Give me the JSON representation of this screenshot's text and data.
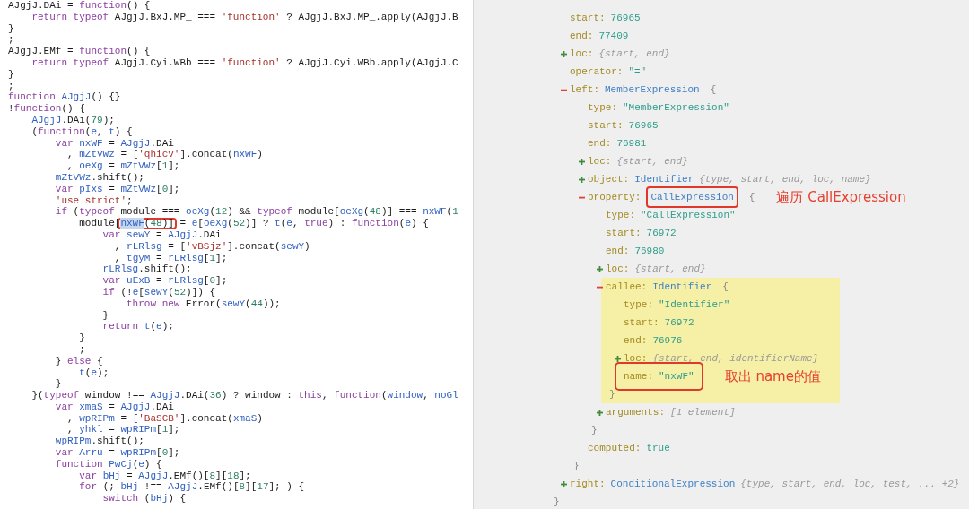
{
  "code": {
    "lines": [
      [
        {
          "kind": "plain",
          "text": "AJgjJ.DAi = "
        },
        {
          "kind": "keyword",
          "text": "function"
        },
        {
          "kind": "plain",
          "text": "() {"
        }
      ],
      [
        {
          "kind": "keyword",
          "text": "    return typeof"
        },
        {
          "kind": "plain",
          "text": " AJgjJ.BxJ.MP_ === "
        },
        {
          "kind": "string",
          "text": "'function'"
        },
        {
          "kind": "plain",
          "text": " ? AJgjJ.BxJ.MP_.apply(AJgjJ.B"
        }
      ],
      [
        {
          "kind": "plain",
          "text": "}"
        }
      ],
      [
        {
          "kind": "plain",
          "text": ";"
        }
      ],
      [
        {
          "kind": "plain",
          "text": "AJgjJ.EMf = "
        },
        {
          "kind": "keyword",
          "text": "function"
        },
        {
          "kind": "plain",
          "text": "() {"
        }
      ],
      [
        {
          "kind": "keyword",
          "text": "    return typeof"
        },
        {
          "kind": "plain",
          "text": " AJgjJ.Cyi.WBb === "
        },
        {
          "kind": "string",
          "text": "'function'"
        },
        {
          "kind": "plain",
          "text": " ? AJgjJ.Cyi.WBb.apply(AJgjJ.C"
        }
      ],
      [
        {
          "kind": "plain",
          "text": "}"
        }
      ],
      [
        {
          "kind": "plain",
          "text": ";"
        }
      ],
      [
        {
          "kind": "keyword",
          "text": "function "
        },
        {
          "kind": "name",
          "text": "AJgjJ"
        },
        {
          "kind": "plain",
          "text": "() {}"
        }
      ],
      [
        {
          "kind": "plain",
          "text": "!"
        },
        {
          "kind": "keyword",
          "text": "function"
        },
        {
          "kind": "plain",
          "text": "() {"
        }
      ],
      [
        {
          "kind": "name",
          "text": "    AJgjJ"
        },
        {
          "kind": "plain",
          "text": ".DAi("
        },
        {
          "kind": "number",
          "text": "79"
        },
        {
          "kind": "plain",
          "text": ");"
        }
      ],
      [
        {
          "kind": "plain",
          "text": "    ("
        },
        {
          "kind": "keyword",
          "text": "function"
        },
        {
          "kind": "plain",
          "text": "("
        },
        {
          "kind": "name",
          "text": "e"
        },
        {
          "kind": "plain",
          "text": ", "
        },
        {
          "kind": "name",
          "text": "t"
        },
        {
          "kind": "plain",
          "text": ") {"
        }
      ],
      [
        {
          "kind": "keyword",
          "text": "        var "
        },
        {
          "kind": "name",
          "text": "nxWF"
        },
        {
          "kind": "plain",
          "text": " = "
        },
        {
          "kind": "name",
          "text": "AJgjJ"
        },
        {
          "kind": "plain",
          "text": ".DAi"
        }
      ],
      [
        {
          "kind": "plain",
          "text": "          , "
        },
        {
          "kind": "name",
          "text": "mZtVWz"
        },
        {
          "kind": "plain",
          "text": " = ["
        },
        {
          "kind": "string",
          "text": "'qhicV'"
        },
        {
          "kind": "plain",
          "text": "].concat("
        },
        {
          "kind": "name",
          "text": "nxWF"
        },
        {
          "kind": "plain",
          "text": ")"
        }
      ],
      [
        {
          "kind": "plain",
          "text": "          , "
        },
        {
          "kind": "name",
          "text": "oeXg"
        },
        {
          "kind": "plain",
          "text": " = "
        },
        {
          "kind": "name",
          "text": "mZtVWz"
        },
        {
          "kind": "plain",
          "text": "["
        },
        {
          "kind": "number",
          "text": "1"
        },
        {
          "kind": "plain",
          "text": "];"
        }
      ],
      [
        {
          "kind": "name",
          "text": "        mZtVWz"
        },
        {
          "kind": "plain",
          "text": ".shift();"
        }
      ],
      [
        {
          "kind": "keyword",
          "text": "        var "
        },
        {
          "kind": "name",
          "text": "pIxs"
        },
        {
          "kind": "plain",
          "text": " = "
        },
        {
          "kind": "name",
          "text": "mZtVWz"
        },
        {
          "kind": "plain",
          "text": "["
        },
        {
          "kind": "number",
          "text": "0"
        },
        {
          "kind": "plain",
          "text": "];"
        }
      ],
      [
        {
          "kind": "string",
          "text": "        'use strict'"
        },
        {
          "kind": "plain",
          "text": ";"
        }
      ],
      [
        {
          "kind": "keyword",
          "text": "        if"
        },
        {
          "kind": "plain",
          "text": " ("
        },
        {
          "kind": "keyword",
          "text": "typeof"
        },
        {
          "kind": "plain",
          "text": " module === "
        },
        {
          "kind": "name",
          "text": "oeXg"
        },
        {
          "kind": "plain",
          "text": "("
        },
        {
          "kind": "number",
          "text": "12"
        },
        {
          "kind": "plain",
          "text": ") && "
        },
        {
          "kind": "keyword",
          "text": "typeof"
        },
        {
          "kind": "plain",
          "text": " module["
        },
        {
          "kind": "name",
          "text": "oeXg"
        },
        {
          "kind": "plain",
          "text": "("
        },
        {
          "kind": "number",
          "text": "48"
        },
        {
          "kind": "plain",
          "text": ")] === "
        },
        {
          "kind": "name",
          "text": "nxWF"
        },
        {
          "kind": "plain",
          "text": "("
        },
        {
          "kind": "number",
          "text": "1"
        }
      ],
      [
        {
          "kind": "plain",
          "text": "            module["
        },
        {
          "kind": "outlined",
          "tokens": [
            {
              "kind": "match",
              "text": "nxWF"
            },
            {
              "kind": "plain",
              "text": "("
            },
            {
              "kind": "number",
              "text": "48"
            },
            {
              "kind": "plain",
              "text": ")]"
            }
          ]
        },
        {
          "kind": "plain",
          "text": " = "
        },
        {
          "kind": "name",
          "text": "e"
        },
        {
          "kind": "plain",
          "text": "["
        },
        {
          "kind": "name",
          "text": "oeXg"
        },
        {
          "kind": "plain",
          "text": "("
        },
        {
          "kind": "number",
          "text": "52"
        },
        {
          "kind": "plain",
          "text": ")] ? "
        },
        {
          "kind": "name",
          "text": "t"
        },
        {
          "kind": "plain",
          "text": "("
        },
        {
          "kind": "name",
          "text": "e"
        },
        {
          "kind": "plain",
          "text": ", "
        },
        {
          "kind": "keyword",
          "text": "true"
        },
        {
          "kind": "plain",
          "text": ") : "
        },
        {
          "kind": "keyword",
          "text": "function"
        },
        {
          "kind": "plain",
          "text": "("
        },
        {
          "kind": "name",
          "text": "e"
        },
        {
          "kind": "plain",
          "text": ") {"
        }
      ],
      [
        {
          "kind": "keyword",
          "text": "                var "
        },
        {
          "kind": "name",
          "text": "sewY"
        },
        {
          "kind": "plain",
          "text": " = "
        },
        {
          "kind": "name",
          "text": "AJgjJ"
        },
        {
          "kind": "plain",
          "text": ".DAi"
        }
      ],
      [
        {
          "kind": "plain",
          "text": "                  , "
        },
        {
          "kind": "name",
          "text": "rLRlsg"
        },
        {
          "kind": "plain",
          "text": " = ["
        },
        {
          "kind": "string",
          "text": "'vBSjz'"
        },
        {
          "kind": "plain",
          "text": "].concat("
        },
        {
          "kind": "name",
          "text": "sewY"
        },
        {
          "kind": "plain",
          "text": ")"
        }
      ],
      [
        {
          "kind": "plain",
          "text": "                  , "
        },
        {
          "kind": "name",
          "text": "tgyM"
        },
        {
          "kind": "plain",
          "text": " = "
        },
        {
          "kind": "name",
          "text": "rLRlsg"
        },
        {
          "kind": "plain",
          "text": "["
        },
        {
          "kind": "number",
          "text": "1"
        },
        {
          "kind": "plain",
          "text": "];"
        }
      ],
      [
        {
          "kind": "name",
          "text": "                rLRlsg"
        },
        {
          "kind": "plain",
          "text": ".shift();"
        }
      ],
      [
        {
          "kind": "keyword",
          "text": "                var "
        },
        {
          "kind": "name",
          "text": "uExB"
        },
        {
          "kind": "plain",
          "text": " = "
        },
        {
          "kind": "name",
          "text": "rLRlsg"
        },
        {
          "kind": "plain",
          "text": "["
        },
        {
          "kind": "number",
          "text": "0"
        },
        {
          "kind": "plain",
          "text": "];"
        }
      ],
      [
        {
          "kind": "keyword",
          "text": "                if"
        },
        {
          "kind": "plain",
          "text": " (!"
        },
        {
          "kind": "name",
          "text": "e"
        },
        {
          "kind": "plain",
          "text": "["
        },
        {
          "kind": "name",
          "text": "sewY"
        },
        {
          "kind": "plain",
          "text": "("
        },
        {
          "kind": "number",
          "text": "52"
        },
        {
          "kind": "plain",
          "text": ")]) {"
        }
      ],
      [
        {
          "kind": "keyword",
          "text": "                    throw new"
        },
        {
          "kind": "plain",
          "text": " Error("
        },
        {
          "kind": "name",
          "text": "sewY"
        },
        {
          "kind": "plain",
          "text": "("
        },
        {
          "kind": "number",
          "text": "44"
        },
        {
          "kind": "plain",
          "text": "));"
        }
      ],
      [
        {
          "kind": "plain",
          "text": "                }"
        }
      ],
      [
        {
          "kind": "keyword",
          "text": "                return "
        },
        {
          "kind": "name",
          "text": "t"
        },
        {
          "kind": "plain",
          "text": "("
        },
        {
          "kind": "name",
          "text": "e"
        },
        {
          "kind": "plain",
          "text": ");"
        }
      ],
      [
        {
          "kind": "plain",
          "text": "            }"
        }
      ],
      [
        {
          "kind": "plain",
          "text": "            ;"
        }
      ],
      [
        {
          "kind": "plain",
          "text": "        } "
        },
        {
          "kind": "keyword",
          "text": "else"
        },
        {
          "kind": "plain",
          "text": " {"
        }
      ],
      [
        {
          "kind": "name",
          "text": "            t"
        },
        {
          "kind": "plain",
          "text": "("
        },
        {
          "kind": "name",
          "text": "e"
        },
        {
          "kind": "plain",
          "text": ");"
        }
      ],
      [
        {
          "kind": "plain",
          "text": "        }"
        }
      ],
      [
        {
          "kind": "plain",
          "text": "    }("
        },
        {
          "kind": "keyword",
          "text": "typeof"
        },
        {
          "kind": "plain",
          "text": " window !== "
        },
        {
          "kind": "name",
          "text": "AJgjJ"
        },
        {
          "kind": "plain",
          "text": ".DAi("
        },
        {
          "kind": "number",
          "text": "36"
        },
        {
          "kind": "plain",
          "text": ") ? window : "
        },
        {
          "kind": "keyword",
          "text": "this"
        },
        {
          "kind": "plain",
          "text": ", "
        },
        {
          "kind": "keyword",
          "text": "function"
        },
        {
          "kind": "plain",
          "text": "("
        },
        {
          "kind": "name",
          "text": "window"
        },
        {
          "kind": "plain",
          "text": ", "
        },
        {
          "kind": "name",
          "text": "noGl"
        }
      ],
      [
        {
          "kind": "keyword",
          "text": "        var "
        },
        {
          "kind": "name",
          "text": "xmaS"
        },
        {
          "kind": "plain",
          "text": " = "
        },
        {
          "kind": "name",
          "text": "AJgjJ"
        },
        {
          "kind": "plain",
          "text": ".DAi"
        }
      ],
      [
        {
          "kind": "plain",
          "text": "          , "
        },
        {
          "kind": "name",
          "text": "wpRIPm"
        },
        {
          "kind": "plain",
          "text": " = ["
        },
        {
          "kind": "string",
          "text": "'BaSCB'"
        },
        {
          "kind": "plain",
          "text": "].concat("
        },
        {
          "kind": "name",
          "text": "xmaS"
        },
        {
          "kind": "plain",
          "text": ")"
        }
      ],
      [
        {
          "kind": "plain",
          "text": "          , "
        },
        {
          "kind": "name",
          "text": "yhkl"
        },
        {
          "kind": "plain",
          "text": " = "
        },
        {
          "kind": "name",
          "text": "wpRIPm"
        },
        {
          "kind": "plain",
          "text": "["
        },
        {
          "kind": "number",
          "text": "1"
        },
        {
          "kind": "plain",
          "text": "];"
        }
      ],
      [
        {
          "kind": "name",
          "text": "        wpRIPm"
        },
        {
          "kind": "plain",
          "text": ".shift();"
        }
      ],
      [
        {
          "kind": "keyword",
          "text": "        var "
        },
        {
          "kind": "name",
          "text": "Arru"
        },
        {
          "kind": "plain",
          "text": " = "
        },
        {
          "kind": "name",
          "text": "wpRIPm"
        },
        {
          "kind": "plain",
          "text": "["
        },
        {
          "kind": "number",
          "text": "0"
        },
        {
          "kind": "plain",
          "text": "];"
        }
      ],
      [
        {
          "kind": "keyword",
          "text": "        function "
        },
        {
          "kind": "name",
          "text": "PwCj"
        },
        {
          "kind": "plain",
          "text": "("
        },
        {
          "kind": "name",
          "text": "e"
        },
        {
          "kind": "plain",
          "text": ") {"
        }
      ],
      [
        {
          "kind": "keyword",
          "text": "            var "
        },
        {
          "kind": "name",
          "text": "bHj"
        },
        {
          "kind": "plain",
          "text": " = "
        },
        {
          "kind": "name",
          "text": "AJgjJ"
        },
        {
          "kind": "plain",
          "text": ".EMf()["
        },
        {
          "kind": "number",
          "text": "8"
        },
        {
          "kind": "plain",
          "text": "]["
        },
        {
          "kind": "number",
          "text": "18"
        },
        {
          "kind": "plain",
          "text": "];"
        }
      ],
      [
        {
          "kind": "keyword",
          "text": "            for"
        },
        {
          "kind": "plain",
          "text": " (; "
        },
        {
          "kind": "name",
          "text": "bHj"
        },
        {
          "kind": "plain",
          "text": " !== "
        },
        {
          "kind": "name",
          "text": "AJgjJ"
        },
        {
          "kind": "plain",
          "text": ".EMf()["
        },
        {
          "kind": "number",
          "text": "8"
        },
        {
          "kind": "plain",
          "text": "]["
        },
        {
          "kind": "number",
          "text": "17"
        },
        {
          "kind": "plain",
          "text": "]; ) {"
        }
      ],
      [
        {
          "kind": "keyword",
          "text": "                switch"
        },
        {
          "kind": "plain",
          "text": " ("
        },
        {
          "kind": "name",
          "text": "bHj"
        },
        {
          "kind": "plain",
          "text": ") {"
        }
      ]
    ]
  },
  "ast": {
    "close": "}",
    "children": [
      {
        "key": "start:",
        "value": "76965"
      },
      {
        "key": "end:",
        "value": "77409"
      },
      {
        "key": "loc:",
        "expanded": false,
        "summary": "{start, end}"
      },
      {
        "key": "operator:",
        "value": "\"=\""
      },
      {
        "key": "left:",
        "type": "MemberExpression",
        "expanded": true,
        "open": "{",
        "close": "}",
        "children": [
          {
            "key": "type:",
            "value": "\"MemberExpression\""
          },
          {
            "key": "start:",
            "value": "76965"
          },
          {
            "key": "end:",
            "value": "76981"
          },
          {
            "key": "loc:",
            "expanded": false,
            "summary": "{start, end}"
          },
          {
            "key": "object:",
            "type": "Identifier",
            "expanded": false,
            "summary": "{type, start, end, loc, name}"
          },
          {
            "key": "property:",
            "type": "CallExpression",
            "expanded": true,
            "open": "{",
            "close": "}",
            "outlined": true,
            "note": "遍历 CallExpression",
            "children": [
              {
                "key": "type:",
                "value": "\"CallExpression\""
              },
              {
                "key": "start:",
                "value": "76972"
              },
              {
                "key": "end:",
                "value": "76980"
              },
              {
                "key": "loc:",
                "expanded": false,
                "summary": "{start, end}"
              },
              {
                "key": "callee:",
                "type": "Identifier",
                "expanded": true,
                "open": "{",
                "close": "}",
                "highlighted": true,
                "children": [
                  {
                    "key": "type:",
                    "value": "\"Identifier\""
                  },
                  {
                    "key": "start:",
                    "value": "76972"
                  },
                  {
                    "key": "end:",
                    "value": "76976"
                  },
                  {
                    "key": "loc:",
                    "expanded": false,
                    "summary": "{start, end, identifierName}"
                  },
                  {
                    "key": "name:",
                    "value": "\"nxWF\"",
                    "outlined": true,
                    "note": "取出 name的值"
                  }
                ]
              },
              {
                "key": "arguments:",
                "expanded": false,
                "summary": "[1 element]"
              }
            ]
          },
          {
            "key": "computed:",
            "value": "true"
          }
        ]
      },
      {
        "key": "right:",
        "type": "ConditionalExpression",
        "expanded": false,
        "summary": "{type, start, end, loc, test, ... +2}"
      }
    ]
  }
}
